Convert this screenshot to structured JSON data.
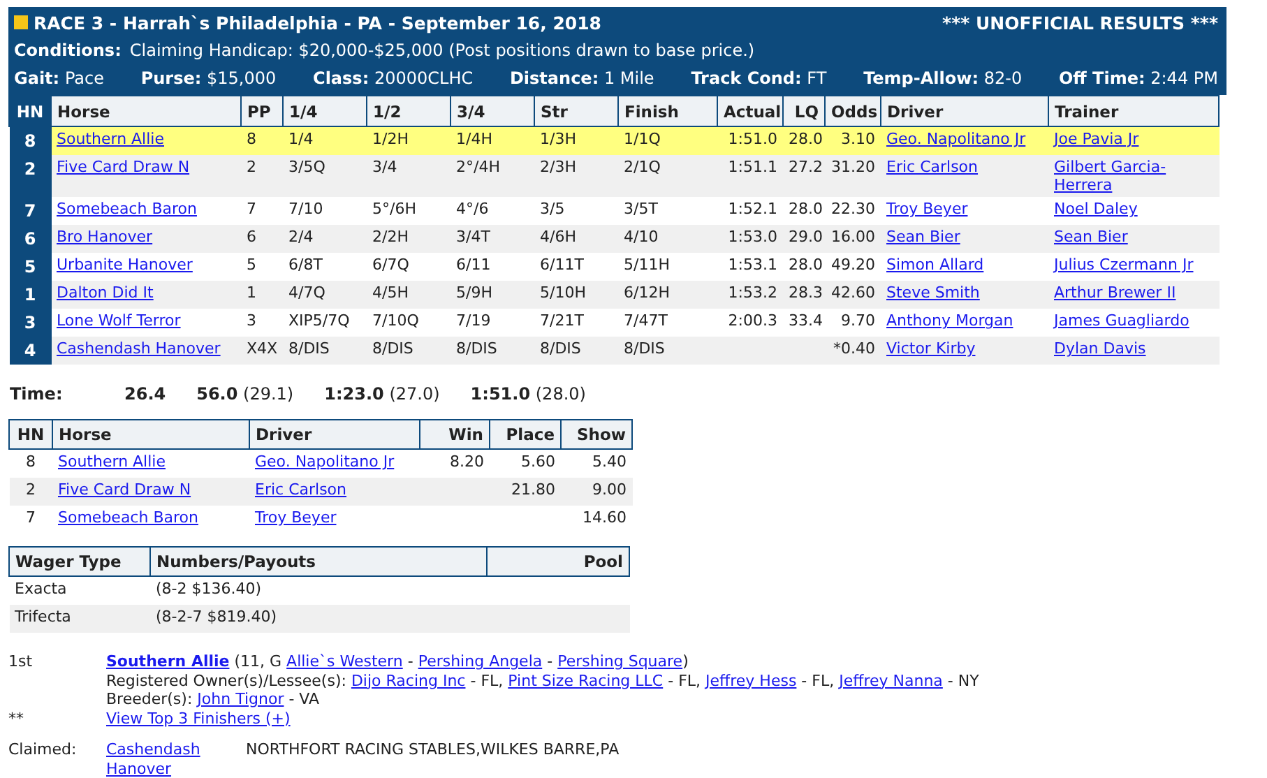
{
  "header": {
    "title": "RACE 3 - Harrah`s Philadelphia - PA - September 16, 2018",
    "status": "*** UNOFFICIAL RESULTS ***",
    "conditions": {
      "label": "Conditions:",
      "value": "Claiming Handicap: $20,000-$25,000 (Post positions drawn to base price.)"
    },
    "facts": [
      {
        "label": "Gait:",
        "value": "Pace"
      },
      {
        "label": "Purse:",
        "value": "$15,000"
      },
      {
        "label": "Class:",
        "value": "20000CLHC"
      },
      {
        "label": "Distance:",
        "value": "1 Mile"
      },
      {
        "label": "Track Cond:",
        "value": "FT"
      },
      {
        "label": "Temp-Allow:",
        "value": "82-0"
      },
      {
        "label": "Off Time:",
        "value": "2:44 PM"
      }
    ]
  },
  "results": {
    "columns": [
      "HN",
      "Horse",
      "PP",
      "1/4",
      "1/2",
      "3/4",
      "Str",
      "Finish",
      "Actual",
      "LQ",
      "Odds",
      "Driver",
      "Trainer"
    ],
    "rows": [
      {
        "hn": "8",
        "horse": "Southern Allie",
        "pp": "8",
        "q1": "1/4",
        "q2": "1/2H",
        "q3": "1/4H",
        "str": "1/3H",
        "finish": "1/1Q",
        "actual": "1:51.0",
        "lq": "28.0",
        "odds": "3.10",
        "driver": "Geo. Napolitano Jr",
        "trainer": "Joe Pavia Jr",
        "highlighted": true
      },
      {
        "hn": "2",
        "horse": "Five Card Draw N",
        "pp": "2",
        "q1": "3/5Q",
        "q2": "3/4",
        "q3": "2°/4H",
        "str": "2/3H",
        "finish": "2/1Q",
        "actual": "1:51.1",
        "lq": "27.2",
        "odds": "31.20",
        "driver": "Eric Carlson",
        "trainer": "Gilbert Garcia-Herrera",
        "highlighted": false
      },
      {
        "hn": "7",
        "horse": "Somebeach Baron",
        "pp": "7",
        "q1": "7/10",
        "q2": "5°/6H",
        "q3": "4°/6",
        "str": "3/5",
        "finish": "3/5T",
        "actual": "1:52.1",
        "lq": "28.0",
        "odds": "22.30",
        "driver": "Troy Beyer",
        "trainer": "Noel Daley",
        "highlighted": false
      },
      {
        "hn": "6",
        "horse": "Bro Hanover",
        "pp": "6",
        "q1": "2/4",
        "q2": "2/2H",
        "q3": "3/4T",
        "str": "4/6H",
        "finish": "4/10",
        "actual": "1:53.0",
        "lq": "29.0",
        "odds": "16.00",
        "driver": "Sean Bier",
        "trainer": "Sean Bier",
        "highlighted": false
      },
      {
        "hn": "5",
        "horse": "Urbanite Hanover",
        "pp": "5",
        "q1": "6/8T",
        "q2": "6/7Q",
        "q3": "6/11",
        "str": "6/11T",
        "finish": "5/11H",
        "actual": "1:53.1",
        "lq": "28.0",
        "odds": "49.20",
        "driver": "Simon Allard",
        "trainer": "Julius Czermann Jr",
        "highlighted": false
      },
      {
        "hn": "1",
        "horse": "Dalton Did It",
        "pp": "1",
        "q1": "4/7Q",
        "q2": "4/5H",
        "q3": "5/9H",
        "str": "5/10H",
        "finish": "6/12H",
        "actual": "1:53.2",
        "lq": "28.3",
        "odds": "42.60",
        "driver": "Steve Smith",
        "trainer": "Arthur Brewer II",
        "highlighted": false
      },
      {
        "hn": "3",
        "horse": "Lone Wolf Terror",
        "pp": "3",
        "q1": "XIP5/7Q",
        "q2": "7/10Q",
        "q3": "7/19",
        "str": "7/21T",
        "finish": "7/47T",
        "actual": "2:00.3",
        "lq": "33.4",
        "odds": "9.70",
        "driver": "Anthony Morgan",
        "trainer": "James Guagliardo",
        "highlighted": false
      },
      {
        "hn": "4",
        "horse": "Cashendash Hanover",
        "pp": "X4X",
        "q1": "8/DIS",
        "q2": "8/DIS",
        "q3": "8/DIS",
        "str": "8/DIS",
        "finish": "8/DIS",
        "odds": "*0.40",
        "driver": "Victor Kirby",
        "trainer": "Dylan Davis",
        "highlighted": false
      }
    ]
  },
  "time": {
    "label": "Time:",
    "splits": [
      {
        "time": "26.4"
      },
      {
        "time": "56.0",
        "quarter": "(29.1)"
      },
      {
        "time": "1:23.0",
        "quarter": "(27.0)"
      },
      {
        "time": "1:51.0",
        "quarter": "(28.0)"
      }
    ]
  },
  "payouts": {
    "columns": [
      "HN",
      "Horse",
      "Driver",
      "Win",
      "Place",
      "Show"
    ],
    "rows": [
      {
        "hn": "8",
        "horse": "Southern Allie",
        "driver": "Geo. Napolitano Jr",
        "win": "8.20",
        "place": "5.60",
        "show": "5.40"
      },
      {
        "hn": "2",
        "horse": "Five Card Draw N",
        "driver": "Eric Carlson",
        "place": "21.80",
        "show": "9.00"
      },
      {
        "hn": "7",
        "horse": "Somebeach Baron",
        "driver": "Troy Beyer",
        "show": "14.60"
      }
    ]
  },
  "wagers": {
    "columns": [
      "Wager Type",
      "Numbers/Payouts",
      "Pool"
    ],
    "rows": [
      {
        "type": "Exacta",
        "payout": "(8-2 $136.40)"
      },
      {
        "type": "Trifecta",
        "payout": "(8-2-7 $819.40)"
      }
    ]
  },
  "winner": {
    "place": "1st",
    "horse": "Southern Allie",
    "pedigree": [
      {
        "kind": "plain",
        "text": "(11, G "
      },
      {
        "kind": "link",
        "text": "Allie`s Western"
      },
      {
        "kind": "plain",
        "text": " - "
      },
      {
        "kind": "link",
        "text": "Pershing Angela"
      },
      {
        "kind": "plain",
        "text": " - "
      },
      {
        "kind": "link",
        "text": "Pershing Square"
      },
      {
        "kind": "plain",
        "text": ")"
      }
    ],
    "owners": [
      {
        "kind": "plain",
        "text": "Registered Owner(s)/Lessee(s): "
      },
      {
        "kind": "link",
        "text": "Dijo Racing Inc"
      },
      {
        "kind": "plain",
        "text": " - FL, "
      },
      {
        "kind": "link",
        "text": "Pint Size Racing LLC"
      },
      {
        "kind": "plain",
        "text": " - FL, "
      },
      {
        "kind": "link",
        "text": "Jeffrey Hess"
      },
      {
        "kind": "plain",
        "text": " - FL, "
      },
      {
        "kind": "link",
        "text": "Jeffrey Nanna"
      },
      {
        "kind": "plain",
        "text": " - NY"
      }
    ],
    "breeders": [
      {
        "kind": "plain",
        "text": "Breeder(s): "
      },
      {
        "kind": "link",
        "text": "John Tignor"
      },
      {
        "kind": "plain",
        "text": " - VA"
      }
    ],
    "more_mark": "**",
    "more_link": "View Top 3 Finishers (+)"
  },
  "claimed": {
    "label": "Claimed:",
    "horse": "Cashendash Hanover",
    "by": "NORTHFORT RACING STABLES,WILKES BARRE,PA"
  }
}
